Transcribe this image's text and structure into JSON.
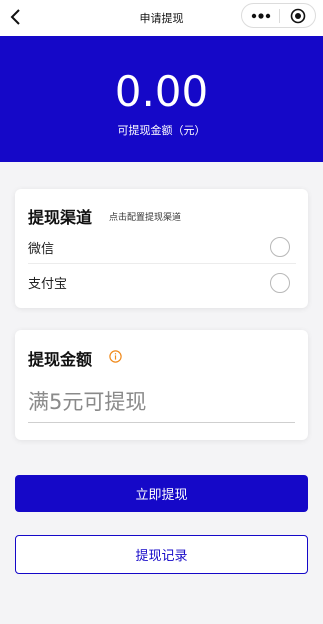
{
  "nav": {
    "title": "申请提现",
    "back_icon": "chevron-left-icon",
    "more_icon": "more-dots-icon",
    "close_icon": "target-circle-icon"
  },
  "hero": {
    "amount": "0.00",
    "label": "可提现金额（元）"
  },
  "channel": {
    "title": "提现渠道",
    "subtitle": "点击配置提现渠道",
    "options": [
      {
        "label": "微信",
        "selected": false
      },
      {
        "label": "支付宝",
        "selected": false
      }
    ]
  },
  "amount": {
    "title": "提现金额",
    "info_icon": "info-icon",
    "placeholder": "满5元可提现",
    "value": ""
  },
  "actions": {
    "submit_label": "立即提现",
    "records_label": "提现记录"
  },
  "colors": {
    "primary": "#1508c8",
    "info_icon": "#f08a1c"
  }
}
